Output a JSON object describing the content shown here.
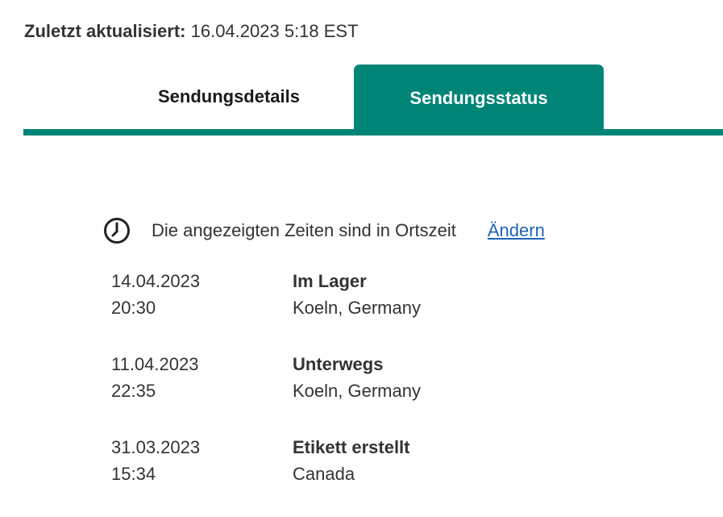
{
  "header": {
    "last_updated_label": "Zuletzt aktualisiert:",
    "last_updated_value": "16.04.2023 5:18 EST"
  },
  "tabs": [
    {
      "label": "Sendungsdetails",
      "active": false
    },
    {
      "label": "Sendungsstatus",
      "active": true
    }
  ],
  "timezone": {
    "icon": "clock-icon",
    "text": "Die angezeigten Zeiten sind in Ortszeit",
    "change_link": "Ändern"
  },
  "events": [
    {
      "date": "14.04.2023",
      "time": "20:30",
      "status": "Im Lager",
      "location": "Koeln, Germany"
    },
    {
      "date": "11.04.2023",
      "time": "22:35",
      "status": "Unterwegs",
      "location": "Koeln, Germany"
    },
    {
      "date": "31.03.2023",
      "time": "15:34",
      "status": "Etikett erstellt",
      "location": "Canada"
    }
  ],
  "colors": {
    "accent": "#008577",
    "link": "#1e64b4",
    "text": "#333333"
  }
}
